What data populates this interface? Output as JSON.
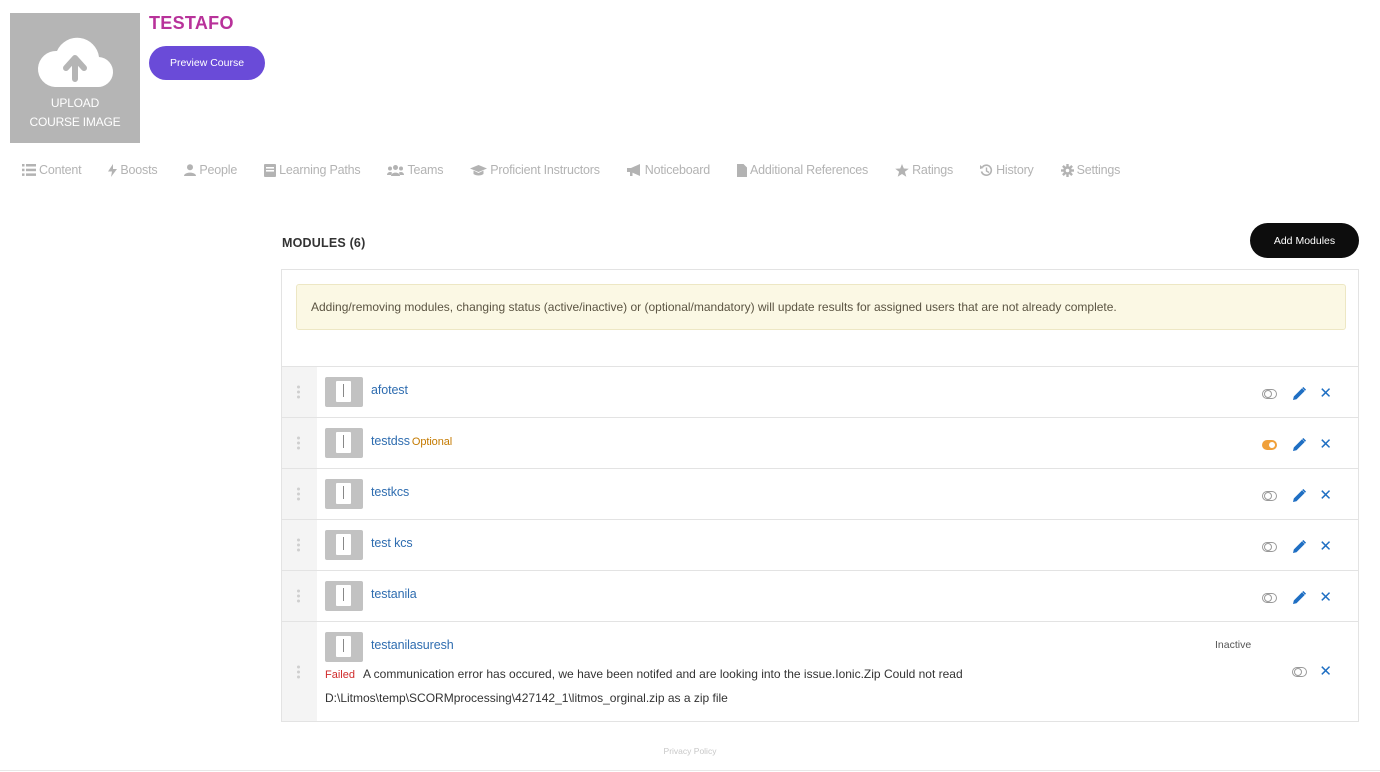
{
  "course": {
    "upload_label_line1": "UPLOAD",
    "upload_label_line2": "COURSE IMAGE",
    "title": "TESTAFO",
    "preview_button": "Preview Course"
  },
  "tabs": [
    {
      "label": "Content",
      "icon": "list-icon"
    },
    {
      "label": "Boosts",
      "icon": "bolt-icon"
    },
    {
      "label": "People",
      "icon": "user-icon"
    },
    {
      "label": "Learning Paths",
      "icon": "book-icon"
    },
    {
      "label": "Teams",
      "icon": "users-icon"
    },
    {
      "label": "Proficient Instructors",
      "icon": "graduation-cap-icon"
    },
    {
      "label": "Noticeboard",
      "icon": "megaphone-icon"
    },
    {
      "label": "Additional References",
      "icon": "file-icon"
    },
    {
      "label": "Ratings",
      "icon": "star-icon"
    },
    {
      "label": "History",
      "icon": "history-icon"
    },
    {
      "label": "Settings",
      "icon": "gear-icon"
    }
  ],
  "modules": {
    "heading": "MODULES (6)",
    "add_button": "Add Modules",
    "notice": "Adding/removing modules, changing status (active/inactive) or (optional/mandatory) will update results for assigned users that are not already complete.",
    "items": [
      {
        "name": "afotest",
        "optional_label": "",
        "toggle_on": false
      },
      {
        "name": "testdss",
        "optional_label": "Optional",
        "toggle_on": true
      },
      {
        "name": "testkcs",
        "optional_label": "",
        "toggle_on": false
      },
      {
        "name": "test kcs",
        "optional_label": "",
        "toggle_on": false
      },
      {
        "name": "testanila",
        "optional_label": "",
        "toggle_on": false
      }
    ],
    "failed_item": {
      "name": "testanilasuresh",
      "status": "Inactive",
      "failed_label": "Failed",
      "error_line1": "A communication error has occured, we have been notifed and are looking into the issue.Ionic.Zip Could not read",
      "error_line2": "D:\\Litmos\\temp\\SCORMprocessing\\427142_1\\litmos_orginal.zip as a zip file"
    }
  },
  "footer": {
    "privacy": "Privacy Policy"
  },
  "colors": {
    "title": "#b8329a",
    "preview_button": "#6a4bd8",
    "link": "#2f6db0",
    "toggle_on": "#f0a03a",
    "failed": "#d02b2b"
  }
}
